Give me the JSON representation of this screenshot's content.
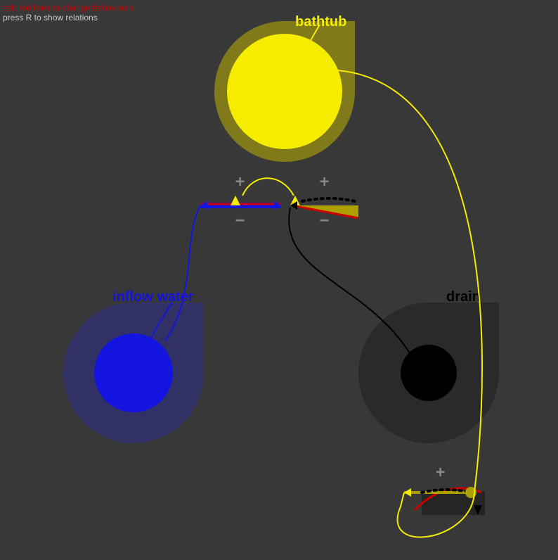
{
  "hints": {
    "edit": "edit red lines to change behaviours",
    "relations": "press R to show relations"
  },
  "nodes": {
    "bathtub": {
      "label": "bathtub",
      "color": "#f5ec00",
      "halo": "#807a1a"
    },
    "inflow": {
      "label": "inflow water",
      "color": "#1414e0",
      "halo": "#313166"
    },
    "drain": {
      "label": "drain",
      "color": "#000000",
      "halo": "#2a2a2a"
    }
  },
  "glyphs": {
    "plus": "+",
    "minus": "−"
  }
}
